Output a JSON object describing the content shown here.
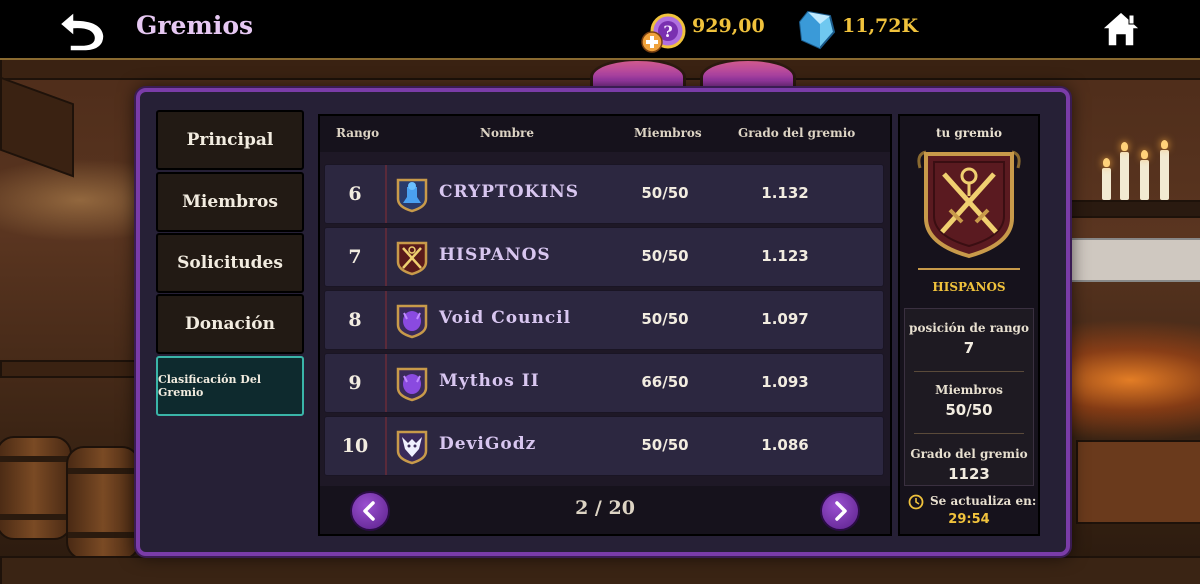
{
  "header": {
    "title": "Gremios",
    "gold": "929,00",
    "gems": "11,72K",
    "gold_icon": "gold-coin-add-icon",
    "gem_icon": "blue-crystal-icon",
    "back_icon": "back-arrow-icon",
    "home_icon": "home-icon"
  },
  "nav": {
    "items": [
      {
        "label": "Principal"
      },
      {
        "label": "Miembros"
      },
      {
        "label": "Solicitudes"
      },
      {
        "label": "Donación"
      },
      {
        "label": "Clasificación Del Gremio"
      }
    ],
    "active_index": 4
  },
  "table": {
    "headers": {
      "rank": "Rango",
      "name": "Nombre",
      "members": "Miembros",
      "grade": "Grado del gremio"
    },
    "rows": [
      {
        "rank": "6",
        "name": "CRYPTOKINS",
        "members": "50/50",
        "grade": "1.132",
        "emblem": "blue-knight-emblem-icon"
      },
      {
        "rank": "7",
        "name": "HISPANOS",
        "members": "50/50",
        "grade": "1.123",
        "emblem": "crossed-swords-emblem-icon"
      },
      {
        "rank": "8",
        "name": "Void Council",
        "members": "50/50",
        "grade": "1.097",
        "emblem": "purple-beast-emblem-icon"
      },
      {
        "rank": "9",
        "name": "Mythos II",
        "members": "66/50",
        "grade": "1.093",
        "emblem": "purple-beast-emblem-icon"
      },
      {
        "rank": "10",
        "name": "DeviGodz",
        "members": "50/50",
        "grade": "1.086",
        "emblem": "white-wolf-emblem-icon"
      }
    ],
    "pager": {
      "text": "2 / 20"
    }
  },
  "my_guild": {
    "heading": "tu gremio",
    "name": "HISPANOS",
    "emblem": "crossed-swords-emblem-icon",
    "rank_label": "posición de rango",
    "rank_value": "7",
    "members_label": "Miembros",
    "members_value": "50/50",
    "grade_label": "Grado del gremio",
    "grade_value": "1123",
    "update_label": "Se actualiza en:",
    "update_time": "29:54"
  },
  "colors": {
    "accent_purple": "#7a3ca8",
    "gold_text": "#f0c23c",
    "active_tab_border": "#3ab4a8",
    "guild_name_text": "#d8c6f0"
  }
}
